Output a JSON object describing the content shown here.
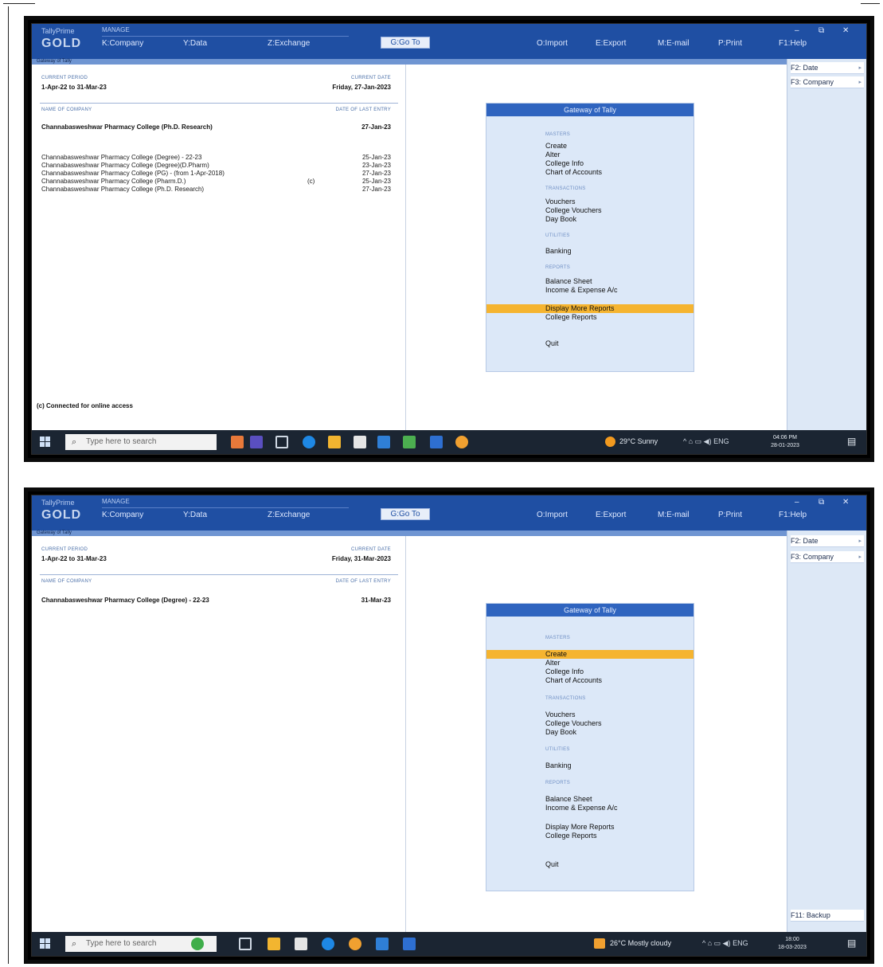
{
  "shot1": {
    "window": {
      "brand_top": "TallyPrime",
      "brand": "GOLD",
      "subtitle": "MANAGE",
      "menu": [
        "K:Company",
        "Y:Data",
        "Z:Exchange"
      ],
      "goto": "G:Go To",
      "menu_right": [
        "O:Import",
        "E:Export",
        "M:E-mail",
        "P:Print",
        "F1:Help"
      ],
      "controls": [
        "–",
        "⧉",
        "✕"
      ],
      "strip_label": "Gateway of Tally"
    },
    "left": {
      "current_period_label": "CURRENT PERIOD",
      "current_period": "1-Apr-22 to 31-Mar-23",
      "current_date_label": "CURRENT DATE",
      "current_date": "Friday, 27-Jan-2023",
      "name_label": "NAME OF COMPANY",
      "last_entry_label": "DATE OF LAST ENTRY",
      "selected_company": "Channabasweshwar Pharmacy College (Ph.D. Research)",
      "selected_date": "27-Jan-23",
      "companies": [
        {
          "name": "Channabasweshwar Pharmacy College (Degree) - 22-23",
          "tag": "",
          "date": "25-Jan-23"
        },
        {
          "name": "Channabasweshwar Pharmacy College (Degree)(D.Pharm)",
          "tag": "",
          "date": "23-Jan-23"
        },
        {
          "name": "Channabasweshwar Pharmacy College (PG) - (from 1-Apr-2018)",
          "tag": "",
          "date": "27-Jan-23"
        },
        {
          "name": "Channabasweshwar Pharmacy College (Pharm.D.)",
          "tag": "(c)",
          "date": "25-Jan-23"
        },
        {
          "name": "Channabasweshwar Pharmacy College (Ph.D. Research)",
          "tag": "",
          "date": "27-Jan-23"
        }
      ],
      "connected": "(c) Connected for online access"
    },
    "gateway": {
      "title": "Gateway of Tally",
      "sections": {
        "masters": "MASTERS",
        "transactions": "TRANSACTIONS",
        "utilities": "UTILITIES",
        "reports": "REPORTS"
      },
      "items": {
        "create": "Create",
        "alter": "Alter",
        "college_info": "College Info",
        "chart": "Chart of Accounts",
        "vouchers": "Vouchers",
        "college_vouchers": "College Vouchers",
        "day_book": "Day Book",
        "banking": "Banking",
        "balance_sheet": "Balance Sheet",
        "income": "Income & Expense A/c",
        "display_more": "Display More Reports",
        "college_reports": "College Reports",
        "quit": "Quit"
      },
      "highlighted": "Display More Reports"
    },
    "sidebar": {
      "keys": [
        "F2: Date",
        "F3: Company"
      ]
    },
    "taskbar": {
      "search_placeholder": "Type here to search",
      "weather": "29°C  Sunny",
      "tray": "^  ⌂  ▭  ◀)  ENG",
      "time": "04:06 PM",
      "date": "28-01-2023"
    }
  },
  "shot2": {
    "window": {
      "brand_top": "TallyPrime",
      "brand": "GOLD",
      "subtitle": "MANAGE",
      "menu": [
        "K:Company",
        "Y:Data",
        "Z:Exchange"
      ],
      "goto": "G:Go To",
      "menu_right": [
        "O:Import",
        "E:Export",
        "M:E-mail",
        "P:Print",
        "F1:Help"
      ],
      "controls": [
        "–",
        "⧉",
        "✕"
      ],
      "strip_label": "Gateway of Tally"
    },
    "left": {
      "current_period_label": "CURRENT PERIOD",
      "current_period": "1-Apr-22 to 31-Mar-23",
      "current_date_label": "CURRENT DATE",
      "current_date": "Friday, 31-Mar-2023",
      "name_label": "NAME OF COMPANY",
      "last_entry_label": "DATE OF LAST ENTRY",
      "selected_company": "Channabasweshwar Pharmacy College (Degree) - 22-23",
      "selected_date": "31-Mar-23"
    },
    "gateway": {
      "title": "Gateway of Tally",
      "sections": {
        "masters": "MASTERS",
        "transactions": "TRANSACTIONS",
        "utilities": "UTILITIES",
        "reports": "REPORTS"
      },
      "items": {
        "create": "Create",
        "alter": "Alter",
        "college_info": "College Info",
        "chart": "Chart of Accounts",
        "vouchers": "Vouchers",
        "college_vouchers": "College Vouchers",
        "day_book": "Day Book",
        "banking": "Banking",
        "balance_sheet": "Balance Sheet",
        "income": "Income & Expense A/c",
        "display_more": "Display More Reports",
        "college_reports": "College Reports",
        "quit": "Quit"
      },
      "highlighted": "Create"
    },
    "sidebar": {
      "keys": [
        "F2: Date",
        "F3: Company"
      ],
      "bottom_key": "F11: Backup"
    },
    "taskbar": {
      "search_placeholder": "Type here to search",
      "weather": "26°C  Mostly cloudy",
      "tray": "^  ⌂  ▭  ◀)  ENG",
      "time": "18:00",
      "date": "18-03-2023"
    }
  },
  "colors": {
    "tally_blue": "#1f4fa3",
    "highlight": "#f5b430",
    "gateway_bg": "#dce8f8",
    "taskbar": "#1b2532"
  }
}
